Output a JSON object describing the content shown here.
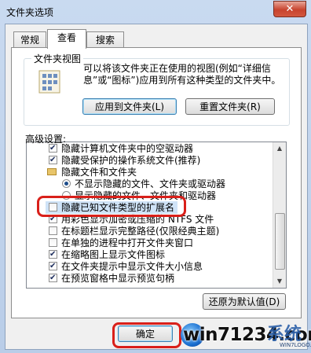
{
  "window": {
    "title": "文件夹选项",
    "close_glyph": "✕"
  },
  "tabs": [
    {
      "label": "常规",
      "active": false
    },
    {
      "label": "查看",
      "active": true
    },
    {
      "label": "搜索",
      "active": false
    }
  ],
  "folder_views": {
    "legend": "文件夹视图",
    "description": "可以将该文件夹正在使用的视图(例如“详细信息”或“图标”)应用到所有这种类型的文件夹中。",
    "apply_button": "应用到文件夹(L)",
    "reset_button": "重置文件夹(R)",
    "icon": "folder-view-icon"
  },
  "advanced": {
    "label": "高级设置:",
    "items": [
      {
        "type": "checkbox",
        "checked": true,
        "label": "隐藏计算机文件夹中的空驱动器"
      },
      {
        "type": "checkbox",
        "checked": true,
        "label": "隐藏受保护的操作系统文件(推荐)"
      },
      {
        "type": "folder",
        "label": "隐藏文件和文件夹"
      },
      {
        "type": "radio",
        "checked": true,
        "label": "不显示隐藏的文件、文件夹或驱动器"
      },
      {
        "type": "radio",
        "checked": false,
        "label": "显示隐藏的文件、文件夹和驱动器"
      },
      {
        "type": "checkbox",
        "checked": false,
        "label": "隐藏已知文件类型的扩展名",
        "selected": true
      },
      {
        "type": "checkbox",
        "checked": true,
        "label": "用彩色显示加密或压缩的 NTFS 文件"
      },
      {
        "type": "checkbox",
        "checked": false,
        "label": "在标题栏显示完整路径(仅限经典主题)"
      },
      {
        "type": "checkbox",
        "checked": false,
        "label": "在单独的进程中打开文件夹窗口"
      },
      {
        "type": "checkbox",
        "checked": true,
        "label": "在缩略图上显示文件图标"
      },
      {
        "type": "checkbox",
        "checked": true,
        "label": "在文件夹提示中显示文件大小信息"
      },
      {
        "type": "checkbox",
        "checked": true,
        "label": "在预览窗格中显示预览句柄"
      }
    ],
    "restore_button": "还原为默认值(D)"
  },
  "footer": {
    "ok_button": "确定"
  },
  "watermark": {
    "text": "win71234.com",
    "mark": "系统",
    "sub": "WIN7LOGO.COM"
  }
}
